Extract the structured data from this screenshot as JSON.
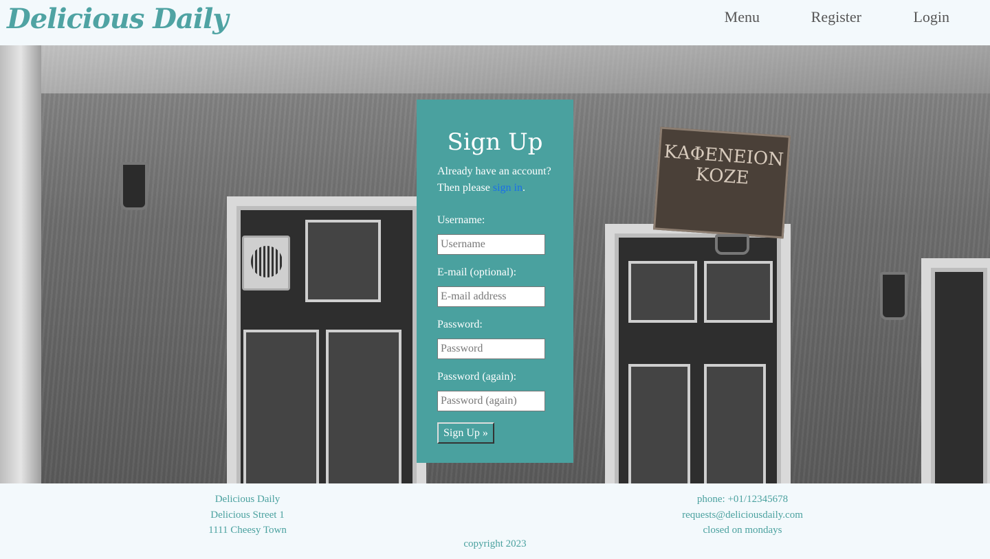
{
  "header": {
    "logo": "Delicious Daily",
    "nav": [
      {
        "label": "Menu"
      },
      {
        "label": "Register"
      },
      {
        "label": "Login"
      }
    ]
  },
  "signup": {
    "title": "Sign Up",
    "intro_line1": "Already have an account?",
    "intro_line2": "Then please",
    "sign_in_link": "sign in",
    "intro_end": ".",
    "fields": [
      {
        "label": "Username:",
        "placeholder": "Username"
      },
      {
        "label": "E-mail (optional):",
        "placeholder": "E-mail address"
      },
      {
        "label": "Password:",
        "placeholder": "Password"
      },
      {
        "label": "Password (again):",
        "placeholder": "Password (again)"
      }
    ],
    "submit_label": "Sign Up »"
  },
  "background": {
    "sign_text": "ΚΑΦΕΝΕΙΟΝ ΚΟΖΕ"
  },
  "footer": {
    "left": [
      "Delicious Daily",
      "Delicious Street 1",
      "1111 Cheesy Town"
    ],
    "right": [
      "phone: +01/12345678",
      "requests@deliciousdaily.com",
      "closed on mondays"
    ],
    "copyright": "copyright 2023"
  },
  "colors": {
    "brand": "#4fa3a3",
    "card": "#4aa19f",
    "link": "#1a6fe8",
    "page_bg": "#f3f9fc"
  }
}
